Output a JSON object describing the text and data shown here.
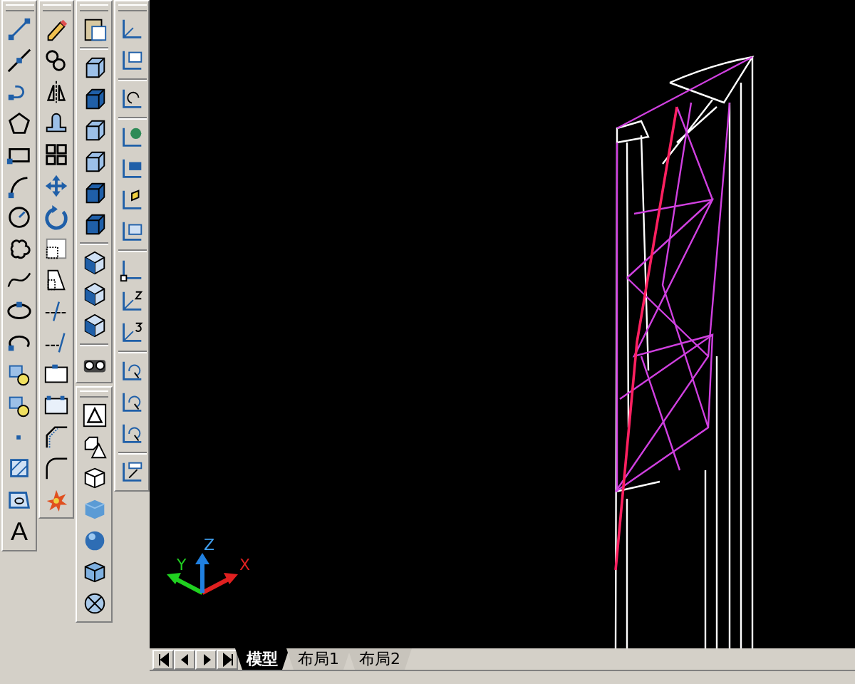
{
  "draw_toolbar": {
    "text_tool": "A"
  },
  "ucs_icon": {
    "x_label": "X",
    "y_label": "Y",
    "z_label": "Z"
  },
  "layout_tabs": [
    {
      "label": "模型",
      "selected": true
    },
    {
      "label": "布局1",
      "selected": false
    },
    {
      "label": "布局2",
      "selected": false
    }
  ]
}
